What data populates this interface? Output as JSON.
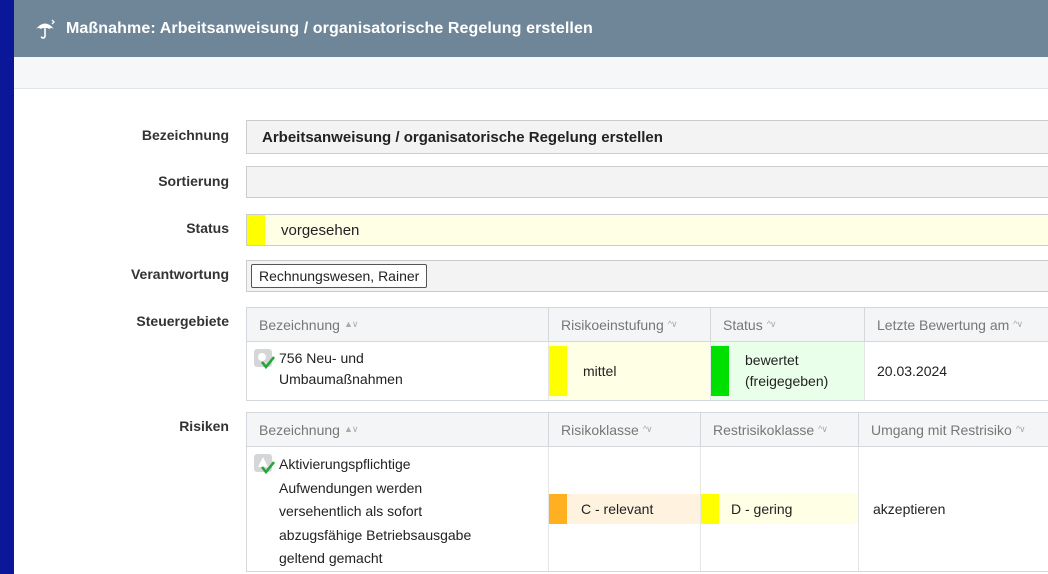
{
  "window": {
    "title": "Maßnahme: Arbeitsanweisung / organisatorische Regelung erstellen",
    "title_icon": "umbrella-icon"
  },
  "form": {
    "bezeichnung_label": "Bezeichnung",
    "bezeichnung_value": "Arbeitsanweisung / organisatorische Regelung erstellen",
    "sortierung_label": "Sortierung",
    "sortierung_value": "",
    "status_label": "Status",
    "status_value": "vorgesehen",
    "status_color": "#ffff00",
    "verantwortung_label": "Verantwortung",
    "verantwortung_value": "Rechnungswesen, Rainer",
    "steuergebiete_label": "Steuergebiete",
    "risiken_label": "Risiken"
  },
  "steuergebiete": {
    "columns": [
      "Bezeichnung",
      "Risikoeinstufung",
      "Status",
      "Letzte Bewertung am"
    ],
    "rows": [
      {
        "icon": "area-check-icon",
        "bezeichnung": "756 Neu- und Umbaumaßnahmen",
        "risikoeinstufung": "mittel",
        "risiko_color": "#ffff00",
        "status": "bewertet (freigegeben)",
        "status_color": "#00e000",
        "letzte_bewertung": "20.03.2024"
      }
    ]
  },
  "risiken": {
    "columns": [
      "Bezeichnung",
      "Risikoklasse",
      "Restrisikoklasse",
      "Umgang mit Restrisiko"
    ],
    "rows": [
      {
        "icon": "risk-check-icon",
        "bezeichnung": "Aktivierungspflichtige Aufwendungen werden versehentlich als sofort abzugsfähige Betriebsausgabe geltend gemacht",
        "risikoklasse": "C - relevant",
        "risikoklasse_color": "#ffb020",
        "restrisikoklasse": "D - gering",
        "restrisikoklasse_color": "#ffff00",
        "umgang": "akzeptieren"
      }
    ]
  }
}
